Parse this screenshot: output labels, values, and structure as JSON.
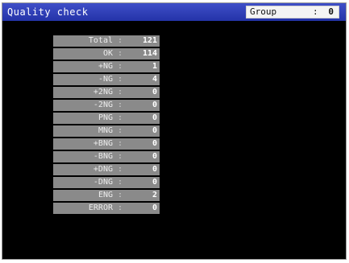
{
  "window": {
    "title": "Quality check"
  },
  "group": {
    "label": "Group",
    "separator": ":",
    "value": "0"
  },
  "rows": [
    {
      "label": "Total",
      "separator": ":",
      "value": "121"
    },
    {
      "label": "OK",
      "separator": ":",
      "value": "114"
    },
    {
      "label": "+NG",
      "separator": ":",
      "value": "1"
    },
    {
      "label": "-NG",
      "separator": ":",
      "value": "4"
    },
    {
      "label": "+2NG",
      "separator": ":",
      "value": "0"
    },
    {
      "label": "-2NG",
      "separator": ":",
      "value": "0"
    },
    {
      "label": "PNG",
      "separator": ":",
      "value": "0"
    },
    {
      "label": "MNG",
      "separator": ":",
      "value": "0"
    },
    {
      "label": "+BNG",
      "separator": ":",
      "value": "0"
    },
    {
      "label": "-BNG",
      "separator": ":",
      "value": "0"
    },
    {
      "label": "+DNG",
      "separator": ":",
      "value": "0"
    },
    {
      "label": "-DNG",
      "separator": ":",
      "value": "0"
    },
    {
      "label": "ENG",
      "separator": ":",
      "value": "2"
    },
    {
      "label": "ERROR",
      "separator": ":",
      "value": "0"
    }
  ],
  "colors": {
    "title_bar": "#2c3cb8",
    "background": "#000000",
    "row_background": "#8a8a8a",
    "text": "#ffffff"
  }
}
